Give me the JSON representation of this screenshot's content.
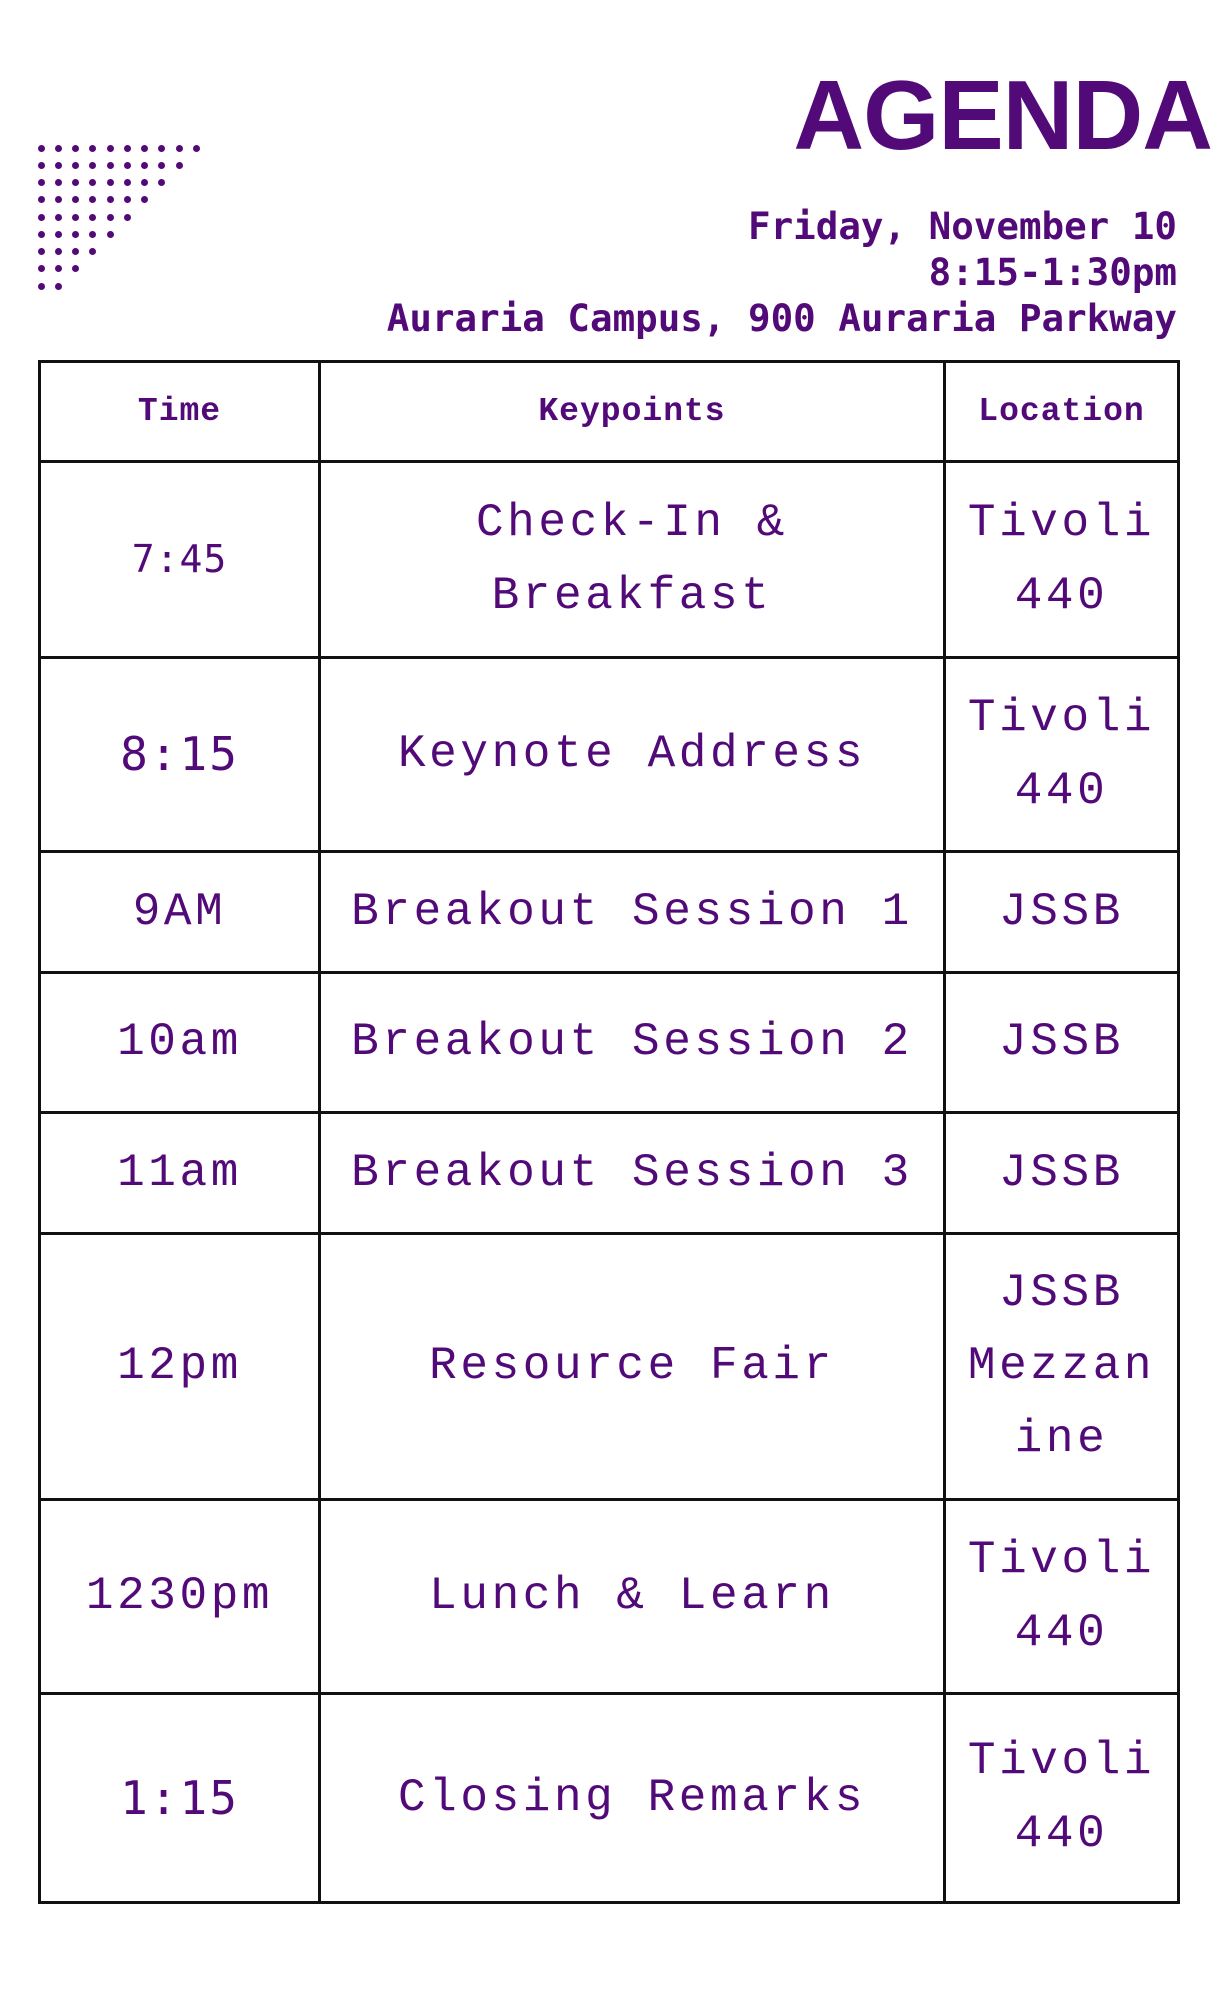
{
  "header": {
    "title": "AGENDA",
    "date": "Friday, November 10",
    "time_range": "8:15-1:30pm",
    "location": "Auraria Campus, 900 Auraria Parkway"
  },
  "colors": {
    "accent": "#520a78",
    "border": "#111111",
    "background": "#ffffff"
  },
  "decoration": {
    "icon": "dot-triangle-pattern"
  },
  "table": {
    "columns": [
      "Time",
      "Keypoints",
      "Location"
    ],
    "rows": [
      {
        "time": "7:45",
        "keypoint": [
          "Check-In &",
          "Breakfast"
        ],
        "location": [
          "Tivoli",
          "440"
        ]
      },
      {
        "time": "8:15",
        "keypoint": [
          "Keynote Address"
        ],
        "location": [
          "Tivoli",
          "440"
        ]
      },
      {
        "time": "9AM",
        "keypoint": [
          "Breakout Session 1"
        ],
        "location": [
          "JSSB"
        ]
      },
      {
        "time": "10am",
        "keypoint": [
          "Breakout Session 2"
        ],
        "location": [
          "JSSB"
        ]
      },
      {
        "time": "11am",
        "keypoint": [
          "Breakout Session 3"
        ],
        "location": [
          "JSSB"
        ]
      },
      {
        "time": "12pm",
        "keypoint": [
          "Resource Fair"
        ],
        "location": [
          "JSSB",
          "Mezzan",
          "ine"
        ]
      },
      {
        "time": "1230pm",
        "keypoint": [
          "Lunch & Learn"
        ],
        "location": [
          "Tivoli",
          "440"
        ]
      },
      {
        "time": "1:15",
        "keypoint": [
          "Closing Remarks"
        ],
        "location": [
          "Tivoli",
          "440"
        ]
      }
    ]
  }
}
